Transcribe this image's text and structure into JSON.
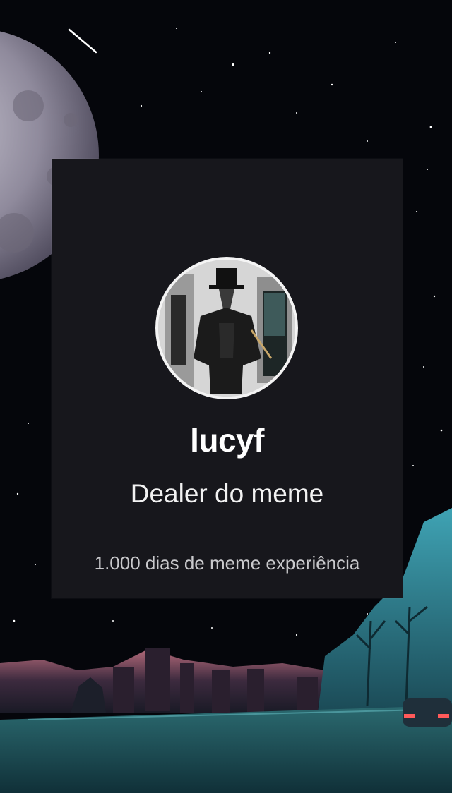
{
  "profile": {
    "username": "lucyf",
    "title": "Dealer do meme",
    "days_text": "1.000 dias de meme experiência"
  },
  "icons": {
    "avatar": "plague-doctor-avatar"
  },
  "colors": {
    "card_bg": "#17171c",
    "avatar_border": "#f4f4f4",
    "sky": "#05060b"
  }
}
